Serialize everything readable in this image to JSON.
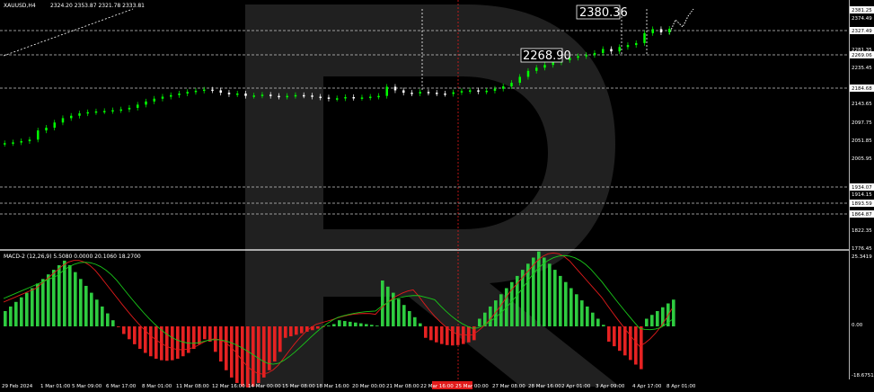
{
  "chart_header": {
    "symbol": "XAUUSD,H4",
    "ohlc": "2324.20 2353.87 2321.78 2333.81"
  },
  "macd_header": "MACD-2 (12,26,9) 5.5080 0.0000 20.1060 18.2700",
  "annotations": {
    "target": "2380.36",
    "pivot": "2268.90"
  },
  "colors": {
    "background": "#000000",
    "up_candle": "#00ff00",
    "down_candle": "#ffffff",
    "grid_dashed": "#c8c8c8",
    "macd_pos": "#2ecc40",
    "macd_neg": "#e52222",
    "signal_red": "#e11b1b",
    "signal_green": "#19c819",
    "watermark": "#3a3a3a"
  },
  "price_axis": [
    "2381.25",
    "2374.49",
    "2327.49",
    "2281.35",
    "2269.06",
    "2235.45",
    "2189.55",
    "2184.68",
    "2143.65",
    "2097.75",
    "2051.85",
    "2005.95",
    "1934.07",
    "1914.15",
    "1893.59",
    "1864.87",
    "1822.35",
    "1776.45"
  ],
  "macd_axis": [
    "25.3419",
    "0.00",
    "-18.6751"
  ],
  "time_axis": [
    "29 Feb 2024",
    "1 Mar 01:00",
    "5 Mar 09:00",
    "6 Mar 17:00",
    "8 Mar 01:00",
    "11 Mar 08:00",
    "12 Mar 16:00",
    "14 Mar 00:00",
    "15 Mar 08:00",
    "18 Mar 16:00",
    "20 Mar 00:00",
    "21 Mar 08:00",
    "22 Mar 16:00",
    "25 Mar 00:00",
    "27 Mar 08:00",
    "28 Mar 16:00",
    "2 Apr 01:00",
    "3 Apr 09:00",
    "4 Apr 17:00",
    "8 Apr 01:00"
  ],
  "price_series": [
    2043,
    2045,
    2048,
    2052,
    2075,
    2082,
    2095,
    2106,
    2112,
    2118,
    2121,
    2123,
    2124,
    2126,
    2128,
    2132,
    2140,
    2148,
    2155,
    2160,
    2164,
    2168,
    2172,
    2175,
    2178,
    2176,
    2170,
    2166,
    2168,
    2162,
    2163,
    2165,
    2162,
    2160,
    2162,
    2164,
    2163,
    2160,
    2158,
    2155,
    2156,
    2159,
    2157,
    2158,
    2160,
    2162,
    2185,
    2176,
    2170,
    2168,
    2172,
    2170,
    2168,
    2167,
    2171,
    2174,
    2176,
    2173,
    2175,
    2180,
    2186,
    2195,
    2210,
    2225,
    2233,
    2240,
    2246,
    2252,
    2258,
    2262,
    2265,
    2270,
    2280,
    2274,
    2285,
    2290,
    2295,
    2320,
    2330,
    2322,
    2331
  ]
}
